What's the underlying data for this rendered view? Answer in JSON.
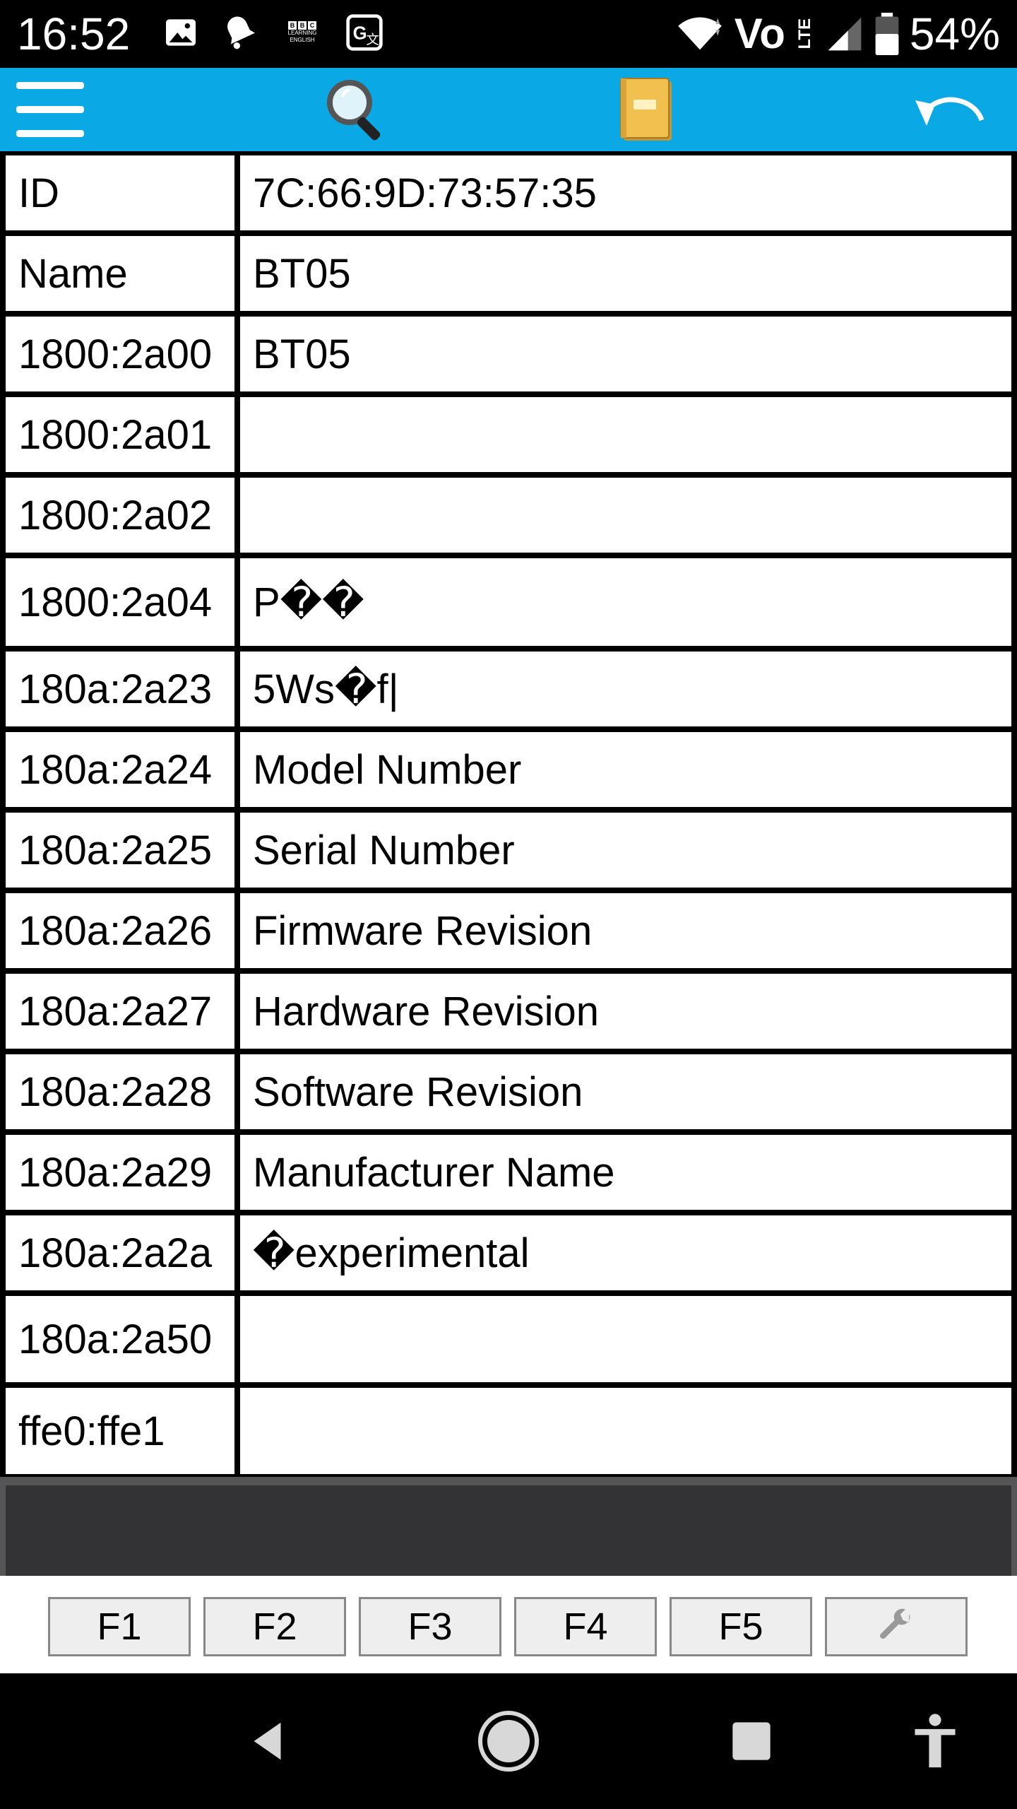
{
  "status_bar": {
    "time": "16:52",
    "network_label": "Vo",
    "lte_label": "LTE",
    "battery_percent": "54%",
    "bbc_badge_text": "LEARNING ENGLISH"
  },
  "toolbar": {
    "icons": [
      "menu-icon",
      "search-icon",
      "notebook-icon",
      "undo-icon"
    ]
  },
  "table": {
    "rows": [
      {
        "key": "ID",
        "value": "7C:66:9D:73:57:35"
      },
      {
        "key": "Name",
        "value": "BT05"
      },
      {
        "key": "1800:2a00",
        "value": "BT05"
      },
      {
        "key": "1800:2a01",
        "value": ""
      },
      {
        "key": "1800:2a02",
        "value": ""
      },
      {
        "key": "1800:2a04",
        "value": "P��"
      },
      {
        "key": "180a:2a23",
        "value": "5Ws�f|"
      },
      {
        "key": "180a:2a24",
        "value": "Model Number"
      },
      {
        "key": "180a:2a25",
        "value": "Serial Number"
      },
      {
        "key": "180a:2a26",
        "value": "Firmware Revision"
      },
      {
        "key": "180a:2a27",
        "value": "Hardware Revision"
      },
      {
        "key": "180a:2a28",
        "value": "Software Revision"
      },
      {
        "key": "180a:2a29",
        "value": "Manufacturer Name"
      },
      {
        "key": "180a:2a2a",
        "value": "�experimental"
      },
      {
        "key": "180a:2a50",
        "value": ""
      },
      {
        "key": "ffe0:ffe1",
        "value": ""
      }
    ]
  },
  "function_keys": [
    "F1",
    "F2",
    "F3",
    "F4",
    "F5"
  ],
  "settings_key_icon": "wrench-icon",
  "nav_bar": {
    "icons": [
      "back-icon",
      "home-icon",
      "recents-icon",
      "accessibility-icon"
    ]
  },
  "colors": {
    "toolbar": "#0aa9e6",
    "panel": "#333335"
  }
}
